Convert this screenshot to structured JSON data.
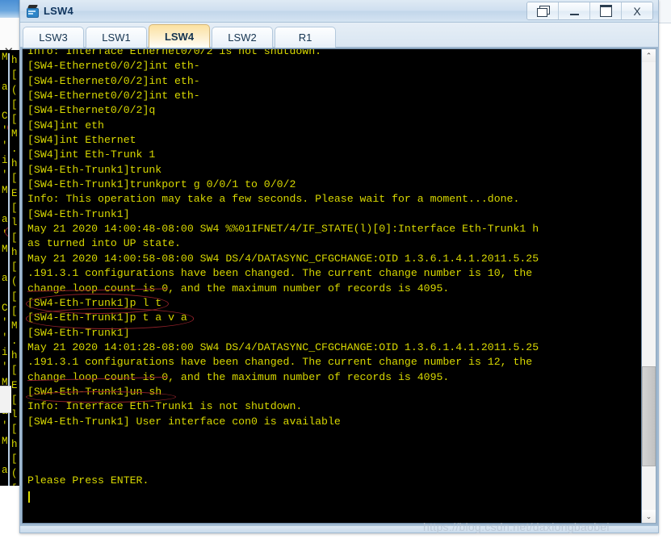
{
  "window": {
    "title": "LSW4",
    "icon": "switch-icon",
    "buttons": [
      {
        "name": "restore-window-button",
        "icon": "restore-icon",
        "label": ""
      },
      {
        "name": "minimize-button",
        "icon": "minimize-icon",
        "label": ""
      },
      {
        "name": "maximize-button",
        "icon": "maximize-icon",
        "label": ""
      },
      {
        "name": "close-button",
        "icon": "close-icon",
        "label": "X"
      }
    ]
  },
  "tabs": [
    {
      "label": "LSW3",
      "active": false
    },
    {
      "label": "LSW1",
      "active": false
    },
    {
      "label": "LSW4",
      "active": true
    },
    {
      "label": "LSW2",
      "active": false
    },
    {
      "label": "R1",
      "active": false
    }
  ],
  "terminal": {
    "foreground_color": "#d8d800",
    "background_color": "#000000",
    "annotation_color": "#94222a",
    "lines": [
      "Info: Interface Ethernet0/0/2 is not shutdown.",
      "[SW4-Ethernet0/0/2]int eth-",
      "[SW4-Ethernet0/0/2]int eth-",
      "[SW4-Ethernet0/0/2]int eth-",
      "[SW4-Ethernet0/0/2]q",
      "[SW4]int eth",
      "[SW4]int Ethernet",
      "[SW4]int Eth-Trunk 1",
      "[SW4-Eth-Trunk1]trunk",
      "[SW4-Eth-Trunk1]trunkport g 0/0/1 to 0/0/2",
      "Info: This operation may take a few seconds. Please wait for a moment...done.",
      "[SW4-Eth-Trunk1]",
      "May 21 2020 14:00:48-08:00 SW4 %%01IFNET/4/IF_STATE(l)[0]:Interface Eth-Trunk1 h",
      "as turned into UP state.",
      "May 21 2020 14:00:58-08:00 SW4 DS/4/DATASYNC_CFGCHANGE:OID 1.3.6.1.4.1.2011.5.25",
      ".191.3.1 configurations have been changed. The current change number is 10, the",
      "change loop count is 0, and the maximum number of records is 4095.",
      "[SW4-Eth-Trunk1]p l t",
      "[SW4-Eth-Trunk1]p t a v a",
      "[SW4-Eth-Trunk1]",
      "May 21 2020 14:01:28-08:00 SW4 DS/4/DATASYNC_CFGCHANGE:OID 1.3.6.1.4.1.2011.5.25",
      ".191.3.1 configurations have been changed. The current change number is 12, the",
      "change loop count is 0, and the maximum number of records is 4095.",
      "[SW4-Eth-Trunk1]un sh",
      "Info: Interface Eth-Trunk1 is not shutdown.",
      "[SW4-Eth-Trunk1] User interface con0 is available",
      "",
      "",
      "",
      "Please Press ENTER.",
      ""
    ],
    "annotations": [
      {
        "name": "annotation-ellipse-pipe-line-trunk",
        "target": "[SW4-Eth-Trunk1]p l t"
      },
      {
        "name": "annotation-ellipse-port-trunk-allow-vlan-all",
        "target": "[SW4-Eth-Trunk1]p t a v a"
      },
      {
        "name": "annotation-ellipse-undo-shutdown",
        "target": "[SW4-Eth-Trunk1]un sh"
      },
      {
        "name": "annotation-strike-change-loop-count",
        "target": "change loop count is 0,"
      }
    ]
  },
  "scrollbar": {
    "up_arrow": "⌃",
    "down_arrow": "⌄"
  },
  "background": {
    "close_icon_label": "✕",
    "subscript": "2",
    "terminal_snippet": [
      "Ma h",
      " l [",
      "a  (",
      "    [",
      "Cr [",
      "'s M",
      "'s  .",
      "in h",
      "'s  [",
      "Ma E",
      " l [",
      "a  l",
      "'s  ["
    ]
  },
  "watermark": {
    "text": "https://blog.csdn.net/daxiongbaobei"
  }
}
